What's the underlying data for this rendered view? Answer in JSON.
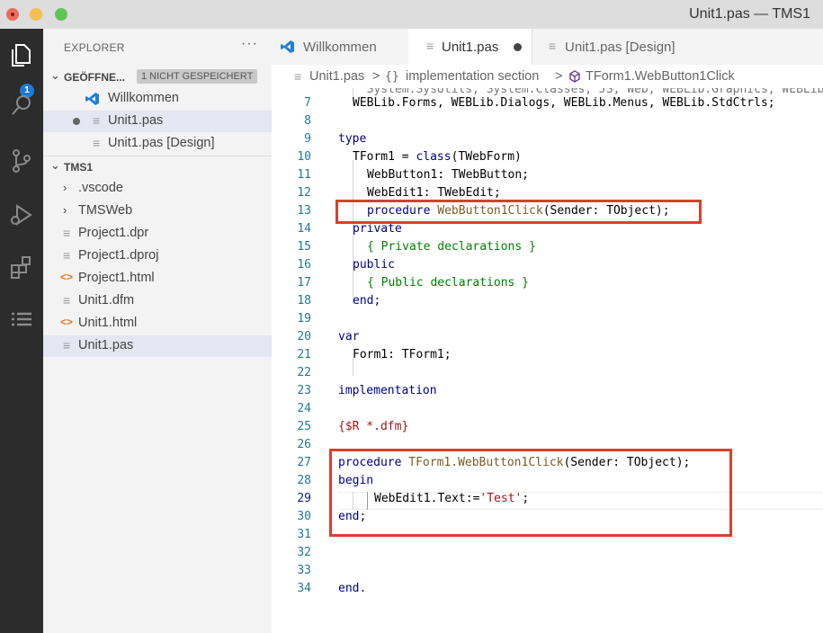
{
  "window": {
    "title": "Unit1.pas — TMS1"
  },
  "activity_bar": {
    "badge_count": "1",
    "items": [
      "explorer-icon",
      "search-icon",
      "source-control-icon",
      "run-debug-icon",
      "extensions-icon",
      "list-icon"
    ]
  },
  "sidebar": {
    "title": "EXPLORER",
    "more": "···",
    "open_editors": {
      "label": "GEÖFFNE...",
      "badge": "1 NICHT GESPEICHERT",
      "items": [
        "Willkommen",
        "Unit1.pas",
        "Unit1.pas [Design]"
      ]
    },
    "project": {
      "label": "TMS1",
      "items": [
        ".vscode",
        "TMSWeb",
        "Project1.dpr",
        "Project1.dproj",
        "Project1.html",
        "Unit1.dfm",
        "Unit1.html",
        "Unit1.pas"
      ]
    }
  },
  "tabs": [
    "Willkommen",
    "Unit1.pas",
    "Unit1.pas [Design]"
  ],
  "breadcrumb": {
    "file": "Unit1.pas",
    "section": "implementation section",
    "symbol": "TForm1.WebButton1Click",
    "sep": ">",
    "braces": "{}"
  },
  "editor": {
    "line_numbers": [
      "7",
      "8",
      "9",
      "10",
      "11",
      "12",
      "13",
      "14",
      "15",
      "16",
      "17",
      "18",
      "19",
      "20",
      "21",
      "22",
      "23",
      "24",
      "25",
      "26",
      "27",
      "28",
      "29",
      "30",
      "31",
      "32",
      "33",
      "34"
    ],
    "line7_text": "WEBLib.Forms, WEBLib.Dialogs, WEBLib.Menus, WEBLib.StdCtrls;",
    "kw_type": "type",
    "tform_decl_a": "TForm1 = ",
    "kw_class": "class",
    "tform_decl_b": "(TWebForm)",
    "webbutton_decl": "WebButton1: TWebButton;",
    "webedit_decl": "WebEdit1: TWebEdit;",
    "kw_procedure": "procedure",
    "method_name": "WebButton1Click",
    "method_params": "(Sender: TObject);",
    "kw_private": "private",
    "comment_private": "{ Private declarations }",
    "kw_public": "public",
    "comment_public": "{ Public declarations }",
    "kw_end": "end;",
    "kw_var": "var",
    "form_var": "Form1: TForm1;",
    "kw_implementation": "implementation",
    "directive": "{$R *.dfm}",
    "impl_method_name": "TForm1.WebButton1Click",
    "kw_begin": "begin",
    "assign_text": "WebEdit1.Text:=",
    "assign_string": "'Test'",
    "semicolon": ";",
    "final_end": "end."
  }
}
